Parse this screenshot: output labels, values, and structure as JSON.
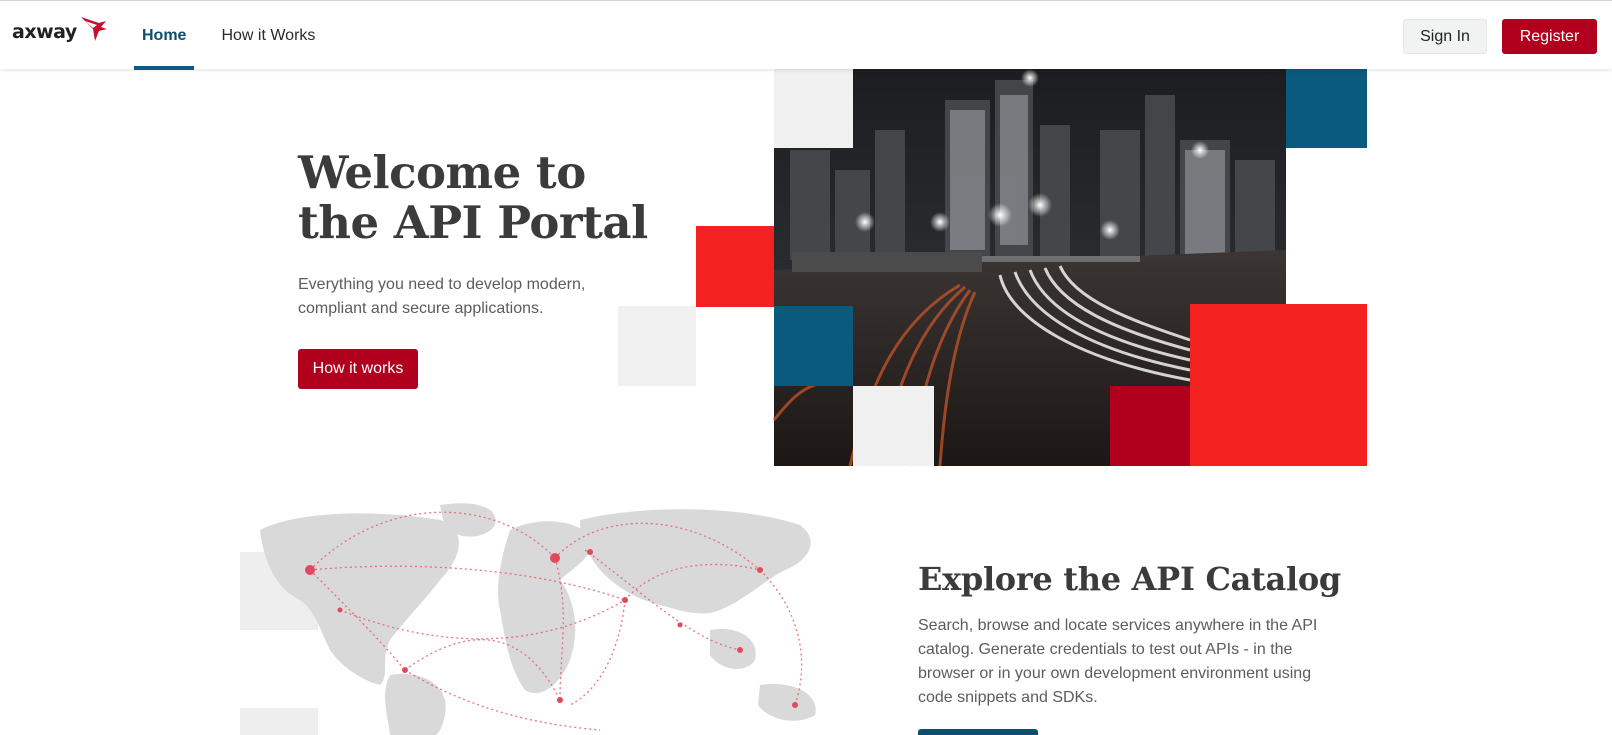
{
  "header": {
    "logo_text": "axway",
    "nav": [
      {
        "label": "Home",
        "active": true
      },
      {
        "label": "How it Works",
        "active": false
      }
    ],
    "sign_in_label": "Sign In",
    "register_label": "Register"
  },
  "hero": {
    "title": "Welcome to the API Portal",
    "subtitle": "Everything you need to develop modern, compliant and secure applications.",
    "cta_label": "How it works"
  },
  "explore": {
    "title": "Explore the API Catalog",
    "body": "Search, browse and locate services anywhere in the API catalog. Generate credentials to test out APIs - in the browser or in your own development environment using code snippets and SDKs."
  },
  "colors": {
    "brand_red": "#b0001e",
    "bright_red": "#f42121",
    "brand_blue": "#0d5a80",
    "light_gray": "#eff0ef"
  },
  "icons": [
    "axway-logo-mark",
    "city-highway-photo",
    "world-map-network"
  ]
}
